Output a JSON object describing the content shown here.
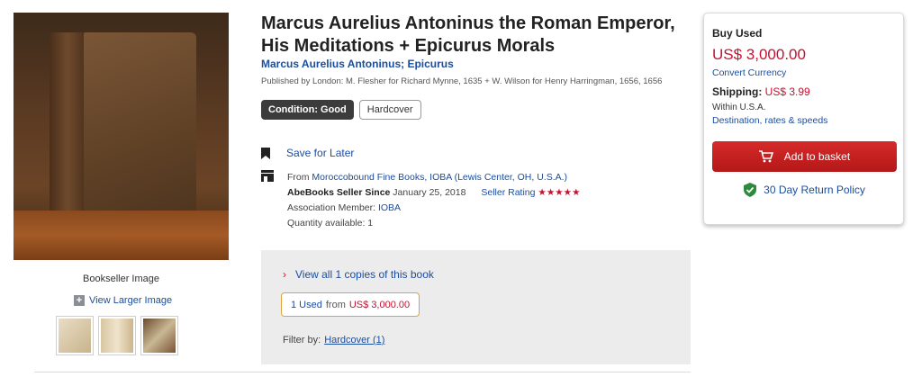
{
  "product": {
    "title": "Marcus Aurelius Antoninus the Roman Emperor, His Meditations + Epicurus Morals",
    "author": "Marcus Aurelius Antoninus; Epicurus",
    "published": "Published by London: M. Flesher for Richard Mynne, 1635 + W. Wilson for Henry Harringman, 1656, 1656",
    "condition": "Condition: Good",
    "binding": "Hardcover"
  },
  "images": {
    "caption": "Bookseller Image",
    "view_larger": "View Larger Image",
    "thumbs": [
      "thumb-1",
      "thumb-2",
      "thumb-3"
    ]
  },
  "actions": {
    "save_label": "Save for Later"
  },
  "seller": {
    "from_prefix": "From ",
    "name": "Moroccobound Fine Books, IOBA (Lewis Center, OH, U.S.A.)",
    "since_label": "AbeBooks Seller Since",
    "since_date": " January 25, 2018",
    "rating_label": "Seller Rating",
    "stars": "★★★★★",
    "assoc_label": "Association Member: ",
    "assoc_value": "IOBA",
    "quantity": "Quantity available: 1"
  },
  "copies": {
    "view_all": "View all 1 copies of this book",
    "used_count": "1 Used",
    "from_text": "from",
    "used_price": "US$ 3,000.00",
    "filter_label": "Filter by:",
    "filter_value": "Hardcover (1)"
  },
  "buy_panel": {
    "heading": "Buy Used",
    "price": "US$ 3,000.00",
    "convert": "Convert Currency",
    "shipping_label": "Shipping:",
    "shipping_value": "US$ 3.99",
    "within": "Within U.S.A.",
    "destination": "Destination, rates & speeds",
    "add_basket": "Add to basket",
    "return_policy": "30 Day Return Policy"
  },
  "colors": {
    "accent_red": "#c8102e",
    "link_blue": "#1a4ea1",
    "shield_green": "#2e8b3e"
  }
}
